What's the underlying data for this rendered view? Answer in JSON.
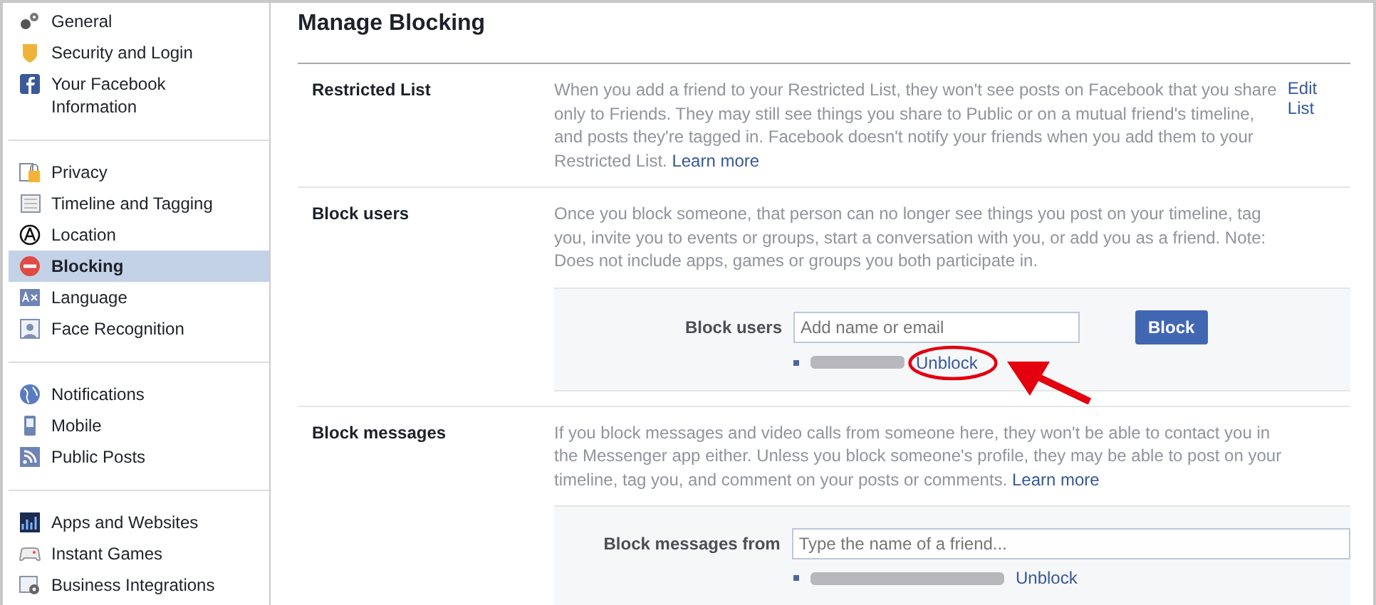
{
  "sidebar": {
    "groups": [
      {
        "items": [
          {
            "label": "General",
            "selected": false
          },
          {
            "label": "Security and Login",
            "selected": false
          },
          {
            "label": "Your Facebook Information",
            "selected": false
          }
        ]
      },
      {
        "items": [
          {
            "label": "Privacy",
            "selected": false
          },
          {
            "label": "Timeline and Tagging",
            "selected": false
          },
          {
            "label": "Location",
            "selected": false
          },
          {
            "label": "Blocking",
            "selected": true
          },
          {
            "label": "Language",
            "selected": false
          },
          {
            "label": "Face Recognition",
            "selected": false
          }
        ]
      },
      {
        "items": [
          {
            "label": "Notifications",
            "selected": false
          },
          {
            "label": "Mobile",
            "selected": false
          },
          {
            "label": "Public Posts",
            "selected": false
          }
        ]
      },
      {
        "items": [
          {
            "label": "Apps and Websites",
            "selected": false
          },
          {
            "label": "Instant Games",
            "selected": false
          },
          {
            "label": "Business Integrations",
            "selected": false
          }
        ]
      }
    ]
  },
  "page_title": "Manage Blocking",
  "sections": [
    {
      "label": "Restricted List",
      "description": "When you add a friend to your Restricted List, they won't see posts on Facebook that you share only to Friends. They may still see things you share to Public or on a mutual friend's timeline, and posts they're tagged in. Facebook doesn't notify your friends when you add them to your Restricted List.",
      "learn_more": "Learn more",
      "action": "Edit List"
    },
    {
      "label": "Block users",
      "description": "Once you block someone, that person can no longer see things you post on your timeline, tag you, invite you to events or groups, start a conversation with you, or add you as a friend. Note: Does not include apps, games or groups you both participate in.",
      "form": {
        "label": "Block users",
        "placeholder": "Add name or email",
        "button": "Block",
        "blocked": [
          {
            "link": "Unblock",
            "annotated": true
          }
        ]
      }
    },
    {
      "label": "Block messages",
      "description": "If you block messages and video calls from someone here, they won't be able to contact you in the Messenger app either. Unless you block someone's profile, they may be able to post on your timeline, tag you, and comment on your posts or comments.",
      "learn_more": "Learn more",
      "form": {
        "label": "Block messages from",
        "placeholder": "Type the name of a friend...",
        "blocked": [
          {
            "link": "Unblock",
            "annotated": false
          }
        ]
      }
    }
  ]
}
